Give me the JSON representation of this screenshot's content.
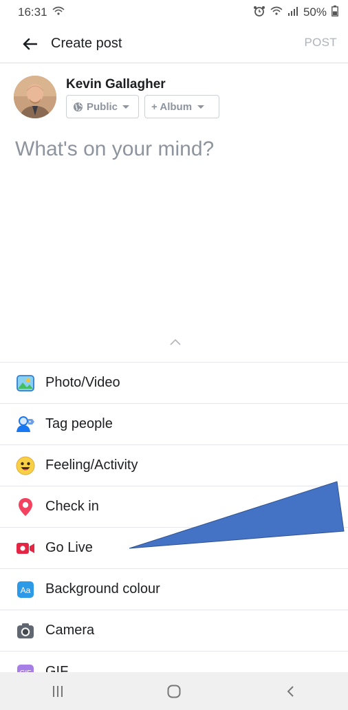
{
  "status_bar": {
    "time": "16:31",
    "battery": "50%"
  },
  "header": {
    "title": "Create post",
    "post_label": "POST"
  },
  "user": {
    "name": "Kevin Gallagher"
  },
  "privacy": {
    "public_label": "Public",
    "album_label": "+ Album"
  },
  "composer": {
    "placeholder": "What's on your mind?"
  },
  "options": [
    {
      "label": "Photo/Video"
    },
    {
      "label": "Tag people"
    },
    {
      "label": "Feeling/Activity"
    },
    {
      "label": "Check in"
    },
    {
      "label": "Go Live"
    },
    {
      "label": "Background colour"
    },
    {
      "label": "Camera"
    },
    {
      "label": "GIF"
    }
  ],
  "colors": {
    "facebook_blue": "#1877f2",
    "annotation_arrow": "#4472c4",
    "disabled_text": "#aeb3bb"
  }
}
